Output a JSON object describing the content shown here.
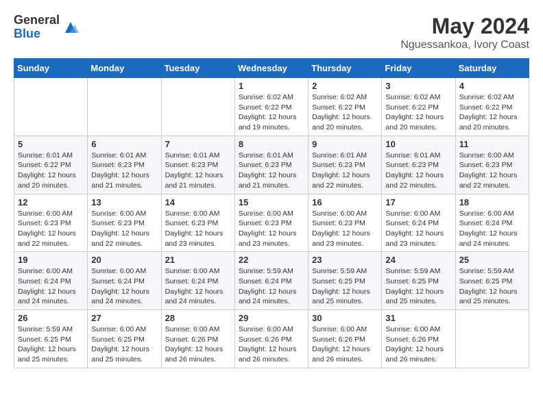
{
  "logo": {
    "general": "General",
    "blue": "Blue"
  },
  "header": {
    "month": "May 2024",
    "location": "Nguessankoa, Ivory Coast"
  },
  "days_of_week": [
    "Sunday",
    "Monday",
    "Tuesday",
    "Wednesday",
    "Thursday",
    "Friday",
    "Saturday"
  ],
  "weeks": [
    [
      {
        "day": "",
        "info": ""
      },
      {
        "day": "",
        "info": ""
      },
      {
        "day": "",
        "info": ""
      },
      {
        "day": "1",
        "info": "Sunrise: 6:02 AM\nSunset: 6:22 PM\nDaylight: 12 hours\nand 19 minutes."
      },
      {
        "day": "2",
        "info": "Sunrise: 6:02 AM\nSunset: 6:22 PM\nDaylight: 12 hours\nand 20 minutes."
      },
      {
        "day": "3",
        "info": "Sunrise: 6:02 AM\nSunset: 6:22 PM\nDaylight: 12 hours\nand 20 minutes."
      },
      {
        "day": "4",
        "info": "Sunrise: 6:02 AM\nSunset: 6:22 PM\nDaylight: 12 hours\nand 20 minutes."
      }
    ],
    [
      {
        "day": "5",
        "info": "Sunrise: 6:01 AM\nSunset: 6:22 PM\nDaylight: 12 hours\nand 20 minutes."
      },
      {
        "day": "6",
        "info": "Sunrise: 6:01 AM\nSunset: 6:23 PM\nDaylight: 12 hours\nand 21 minutes."
      },
      {
        "day": "7",
        "info": "Sunrise: 6:01 AM\nSunset: 6:23 PM\nDaylight: 12 hours\nand 21 minutes."
      },
      {
        "day": "8",
        "info": "Sunrise: 6:01 AM\nSunset: 6:23 PM\nDaylight: 12 hours\nand 21 minutes."
      },
      {
        "day": "9",
        "info": "Sunrise: 6:01 AM\nSunset: 6:23 PM\nDaylight: 12 hours\nand 22 minutes."
      },
      {
        "day": "10",
        "info": "Sunrise: 6:01 AM\nSunset: 6:23 PM\nDaylight: 12 hours\nand 22 minutes."
      },
      {
        "day": "11",
        "info": "Sunrise: 6:00 AM\nSunset: 6:23 PM\nDaylight: 12 hours\nand 22 minutes."
      }
    ],
    [
      {
        "day": "12",
        "info": "Sunrise: 6:00 AM\nSunset: 6:23 PM\nDaylight: 12 hours\nand 22 minutes."
      },
      {
        "day": "13",
        "info": "Sunrise: 6:00 AM\nSunset: 6:23 PM\nDaylight: 12 hours\nand 22 minutes."
      },
      {
        "day": "14",
        "info": "Sunrise: 6:00 AM\nSunset: 6:23 PM\nDaylight: 12 hours\nand 23 minutes."
      },
      {
        "day": "15",
        "info": "Sunrise: 6:00 AM\nSunset: 6:23 PM\nDaylight: 12 hours\nand 23 minutes."
      },
      {
        "day": "16",
        "info": "Sunrise: 6:00 AM\nSunset: 6:23 PM\nDaylight: 12 hours\nand 23 minutes."
      },
      {
        "day": "17",
        "info": "Sunrise: 6:00 AM\nSunset: 6:24 PM\nDaylight: 12 hours\nand 23 minutes."
      },
      {
        "day": "18",
        "info": "Sunrise: 6:00 AM\nSunset: 6:24 PM\nDaylight: 12 hours\nand 24 minutes."
      }
    ],
    [
      {
        "day": "19",
        "info": "Sunrise: 6:00 AM\nSunset: 6:24 PM\nDaylight: 12 hours\nand 24 minutes."
      },
      {
        "day": "20",
        "info": "Sunrise: 6:00 AM\nSunset: 6:24 PM\nDaylight: 12 hours\nand 24 minutes."
      },
      {
        "day": "21",
        "info": "Sunrise: 6:00 AM\nSunset: 6:24 PM\nDaylight: 12 hours\nand 24 minutes."
      },
      {
        "day": "22",
        "info": "Sunrise: 5:59 AM\nSunset: 6:24 PM\nDaylight: 12 hours\nand 24 minutes."
      },
      {
        "day": "23",
        "info": "Sunrise: 5:59 AM\nSunset: 6:25 PM\nDaylight: 12 hours\nand 25 minutes."
      },
      {
        "day": "24",
        "info": "Sunrise: 5:59 AM\nSunset: 6:25 PM\nDaylight: 12 hours\nand 25 minutes."
      },
      {
        "day": "25",
        "info": "Sunrise: 5:59 AM\nSunset: 6:25 PM\nDaylight: 12 hours\nand 25 minutes."
      }
    ],
    [
      {
        "day": "26",
        "info": "Sunrise: 5:59 AM\nSunset: 6:25 PM\nDaylight: 12 hours\nand 25 minutes."
      },
      {
        "day": "27",
        "info": "Sunrise: 6:00 AM\nSunset: 6:25 PM\nDaylight: 12 hours\nand 25 minutes."
      },
      {
        "day": "28",
        "info": "Sunrise: 6:00 AM\nSunset: 6:26 PM\nDaylight: 12 hours\nand 26 minutes."
      },
      {
        "day": "29",
        "info": "Sunrise: 6:00 AM\nSunset: 6:26 PM\nDaylight: 12 hours\nand 26 minutes."
      },
      {
        "day": "30",
        "info": "Sunrise: 6:00 AM\nSunset: 6:26 PM\nDaylight: 12 hours\nand 26 minutes."
      },
      {
        "day": "31",
        "info": "Sunrise: 6:00 AM\nSunset: 6:26 PM\nDaylight: 12 hours\nand 26 minutes."
      },
      {
        "day": "",
        "info": ""
      }
    ]
  ]
}
